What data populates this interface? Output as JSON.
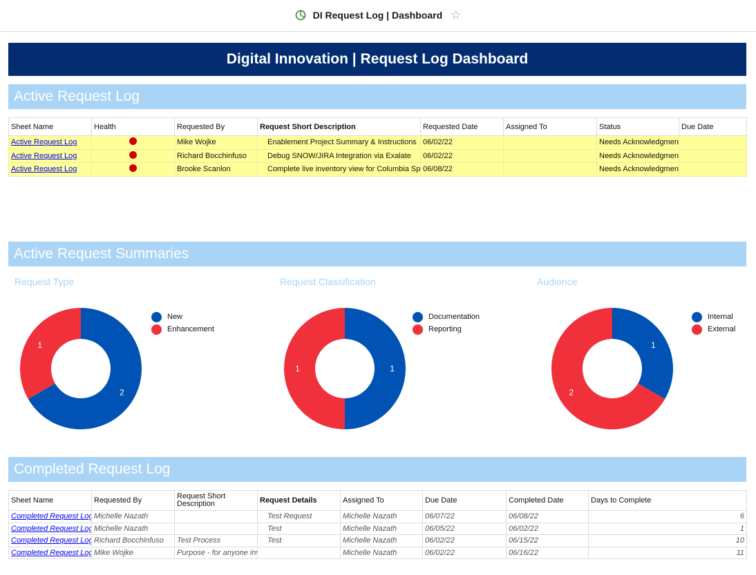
{
  "app": {
    "title": "DI Request Log | Dashboard",
    "icon": "dashboard-icon",
    "star_icon": "star-outline-icon"
  },
  "dashboard_title": "Digital Innovation | Request Log Dashboard",
  "colors": {
    "title_bar": "#032d70",
    "section_bar": "#a9d4f6",
    "active_row": "#ffff99",
    "health_red": "#d10000",
    "series_blue": "#0052b4",
    "series_red": "#f0313b"
  },
  "active": {
    "section_title": "Active Request Log",
    "columns": [
      "Sheet Name",
      "Health",
      "Requested By",
      "Request Short Description",
      "Requested Date",
      "Assigned To",
      "Status",
      "Due Date"
    ],
    "rows": [
      {
        "sheet": "Active Request Log",
        "health": "red",
        "by": "Mike Wojke",
        "desc": "Enablement Project Summary & Instructions",
        "date": "06/02/22",
        "assigned": "",
        "status": "Needs Acknowledgment",
        "due": ""
      },
      {
        "sheet": "Active Request Log",
        "health": "red",
        "by": "Richard Bocchinfuso",
        "desc": "Debug SNOW/JIRA Integration via Exalate",
        "date": "06/02/22",
        "assigned": "",
        "status": "Needs Acknowledgment",
        "due": ""
      },
      {
        "sheet": "Active Request Log",
        "health": "red",
        "by": "Brooke Scanlon",
        "desc": "Complete live inventory view for Columbia Spo",
        "date": "06/08/22",
        "assigned": "",
        "status": "Needs Acknowledgment",
        "due": ""
      }
    ]
  },
  "summaries": {
    "section_title": "Active Request Summaries"
  },
  "chart_data": [
    {
      "type": "pie",
      "title": "Request Type",
      "categories": [
        "New",
        "Enhancement"
      ],
      "values": [
        2,
        1
      ],
      "colors": [
        "#0052b4",
        "#f0313b"
      ],
      "legend": "right"
    },
    {
      "type": "pie",
      "title": "Request Classification",
      "categories": [
        "Documentation",
        "Reporting"
      ],
      "values": [
        1,
        1
      ],
      "colors": [
        "#0052b4",
        "#f0313b"
      ],
      "legend": "right"
    },
    {
      "type": "pie",
      "title": "Audience",
      "categories": [
        "Internal",
        "External"
      ],
      "values": [
        1,
        2
      ],
      "colors": [
        "#0052b4",
        "#f0313b"
      ],
      "legend": "right"
    }
  ],
  "completed": {
    "section_title": "Completed Request Log",
    "columns": [
      "Sheet Name",
      "Requested By",
      "Request Short Description",
      "Request Details",
      "Assigned To",
      "Due Date",
      "Completed Date",
      "Days to Complete"
    ],
    "rows": [
      {
        "sheet": "Completed Request Log",
        "by": "Michelle Nazath",
        "short": "",
        "details": "Test Request",
        "assigned": "Michelle Nazath",
        "due": "06/07/22",
        "completed": "06/08/22",
        "days": "6"
      },
      {
        "sheet": "Completed Request Log",
        "by": "Michelle Nazath",
        "short": "",
        "details": "Test",
        "assigned": "Michelle Nazath",
        "due": "06/05/22",
        "completed": "06/02/22",
        "days": "1"
      },
      {
        "sheet": "Completed Request Log",
        "by": "Richard Bocchinfuso",
        "short": "Test Process",
        "details": "Test",
        "assigned": "Michelle Nazath",
        "due": "06/02/22",
        "completed": "06/15/22",
        "days": "10"
      },
      {
        "sheet": "Completed Request Log",
        "by": "Mike Wojke",
        "short": "Purpose - for anyone inv",
        "details": "",
        "assigned": "Michelle Nazath",
        "due": "06/02/22",
        "completed": "06/16/22",
        "days": "11"
      }
    ]
  }
}
